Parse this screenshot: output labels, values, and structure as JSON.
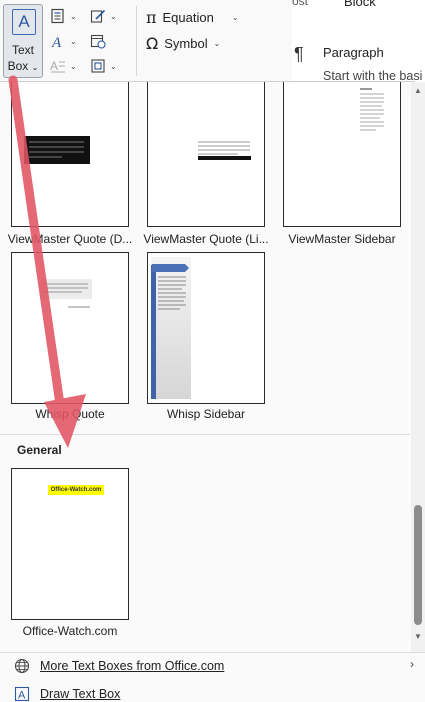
{
  "ribbon": {
    "text_box_label_line1": "Text",
    "text_box_label_line2": "Box",
    "equation_label": "Equation",
    "symbol_label": "Symbol"
  },
  "document_behind": {
    "tab_partial": "ost",
    "tab_block": "Block",
    "paragraph_title": "Paragraph",
    "paragraph_subtitle": "Start with the basi"
  },
  "gallery": {
    "items": [
      {
        "label": "ViewMaster Quote (D..."
      },
      {
        "label": "ViewMaster Quote (Li..."
      },
      {
        "label": "ViewMaster Sidebar"
      },
      {
        "label": "Whisp Quote"
      },
      {
        "label": "Whisp Sidebar"
      }
    ],
    "section_title": "General",
    "general_items": [
      {
        "label": "Office-Watch.com",
        "badge_text": "Office-Watch.com"
      }
    ]
  },
  "footer": {
    "more_text_boxes_label": "More Text Boxes from Office.com",
    "draw_text_box_label": "Draw Text Box"
  },
  "colors": {
    "accent": "#2b5aa0",
    "arrow": "#e25563",
    "highlight": "#ffff00",
    "sidebar_band": "#3e63a8"
  }
}
